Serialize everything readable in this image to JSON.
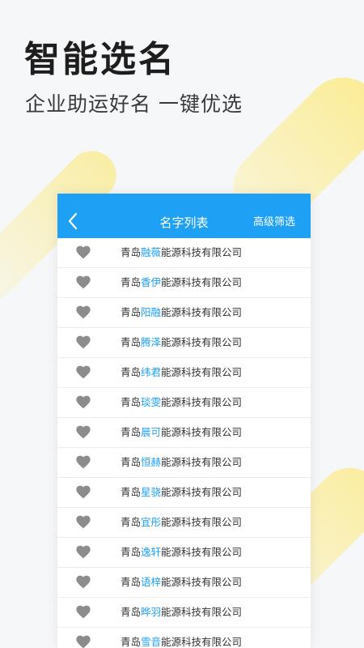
{
  "hero": {
    "title": "智能选名",
    "subtitle": "企业助运好名 一键优选"
  },
  "colors": {
    "accent": "#1ea0f5",
    "heart": "#8c8c8c",
    "text": "#333333"
  },
  "nav": {
    "back_icon": "chevron-left-icon",
    "title": "名字列表",
    "filter_label": "高级筛选"
  },
  "list": {
    "prefix": "青岛",
    "suffix": "能源科技有限公司",
    "item_icon": "heart-icon",
    "items": [
      {
        "keyword": "融薇"
      },
      {
        "keyword": "香伊"
      },
      {
        "keyword": "阳融"
      },
      {
        "keyword": "腾泽"
      },
      {
        "keyword": "纬君"
      },
      {
        "keyword": "琰雯"
      },
      {
        "keyword": "晨可"
      },
      {
        "keyword": "恒赫"
      },
      {
        "keyword": "星骁"
      },
      {
        "keyword": "宜彤"
      },
      {
        "keyword": "逸轩"
      },
      {
        "keyword": "语梓"
      },
      {
        "keyword": "晔羽"
      },
      {
        "keyword": "雪音"
      }
    ]
  }
}
